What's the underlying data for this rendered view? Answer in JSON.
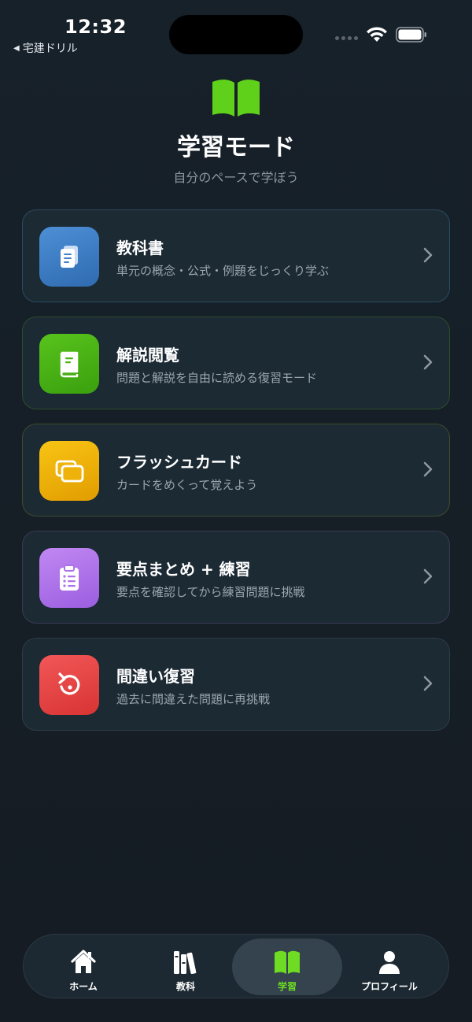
{
  "status_bar": {
    "time": "12:32",
    "back_app": "宅建ドリル"
  },
  "header": {
    "icon": "open-book-icon",
    "title": "学習モード",
    "subtitle": "自分のペースで学ぼう"
  },
  "modes": [
    {
      "icon": "document-icon",
      "title": "教科書",
      "description": "単元の概念・公式・例題をじっくり学ぶ",
      "color": "#3f7fc8"
    },
    {
      "icon": "book-icon",
      "title": "解説閲覧",
      "description": "問題と解説を自由に読める復習モード",
      "color": "#4cb315"
    },
    {
      "icon": "cards-icon",
      "title": "フラッシュカード",
      "description": "カードをめくって覚えよう",
      "color": "#efb20a"
    },
    {
      "icon": "clipboard-list-icon",
      "title": "要点まとめ + 練習",
      "description": "要点を確認してから練習問題に挑戦",
      "color": "#ad72e9"
    },
    {
      "icon": "retry-icon",
      "title": "間違い復習",
      "description": "過去に間違えた問題に再挑戦",
      "color": "#e54444"
    }
  ],
  "tabbar": {
    "items": [
      {
        "icon": "home-icon",
        "label": "ホーム",
        "active": false
      },
      {
        "icon": "books-icon",
        "label": "教科",
        "active": false
      },
      {
        "icon": "open-book-icon",
        "label": "学習",
        "active": true
      },
      {
        "icon": "person-icon",
        "label": "プロフィール",
        "active": false
      }
    ],
    "active_color": "#6ddc22"
  }
}
